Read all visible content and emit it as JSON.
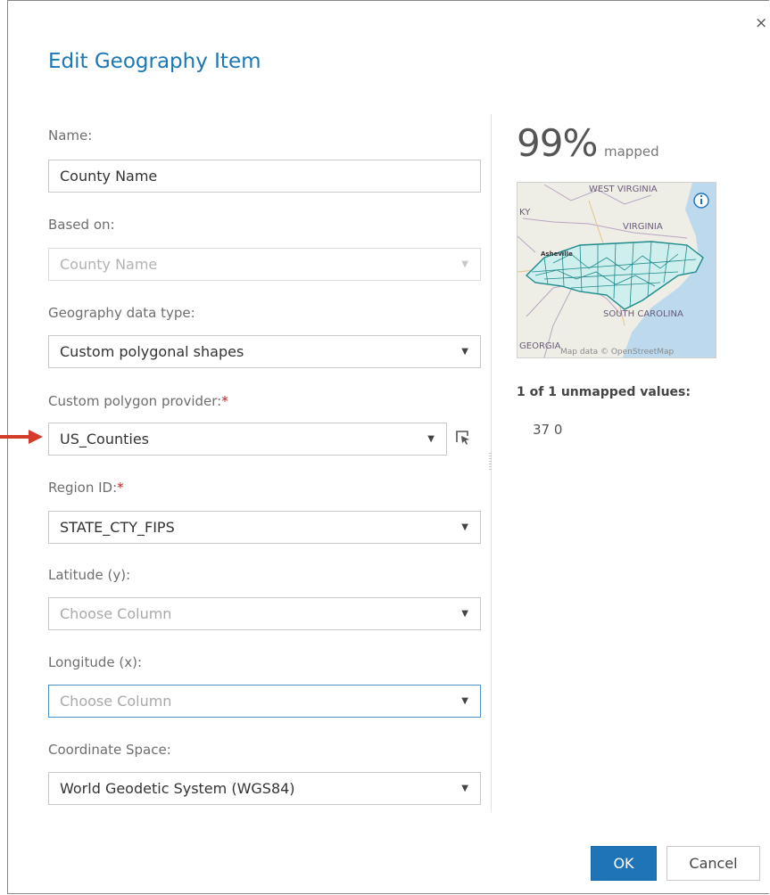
{
  "dialog": {
    "title": "Edit Geography Item",
    "close_label": "×"
  },
  "form": {
    "name_label": "Name:",
    "name_value": "County Name",
    "based_on_label": "Based on:",
    "based_on_value": "County Name",
    "geo_type_label": "Geography data type:",
    "geo_type_value": "Custom polygonal shapes",
    "provider_label": "Custom polygon provider:",
    "provider_value": "US_Counties",
    "region_label": "Region ID:",
    "region_value": "STATE_CTY_FIPS",
    "lat_label": "Latitude (y):",
    "lat_placeholder": "Choose Column",
    "lon_label": "Longitude (x):",
    "lon_placeholder": "Choose Column",
    "coord_label": "Coordinate Space:",
    "coord_value": "World Geodetic System (WGS84)",
    "required_mark": "*"
  },
  "preview": {
    "percent": "99%",
    "percent_label": "mapped",
    "map_labels": {
      "west_virginia": "WEST VIRGINIA",
      "kentucky": "KY",
      "virginia": "VIRGINIA",
      "asheville": "Asheville",
      "south_carolina": "SOUTH CAROLINA",
      "georgia": "GEORGIA",
      "attribution": "Map data © OpenStreetMap"
    },
    "unmapped_title": "1 of 1 unmapped values:",
    "unmapped_values": [
      "37 0"
    ]
  },
  "buttons": {
    "ok": "OK",
    "cancel": "Cancel"
  },
  "icons": {
    "caret": "▼",
    "info": "info-icon",
    "pick": "select-cursor-icon",
    "annotation": "red-arrow"
  },
  "colors": {
    "title": "#1a78b5",
    "primary": "#1f74b8",
    "required": "#c21d1d",
    "focus": "#4a90c8",
    "map_water": "#bcd9ee",
    "map_land": "#eeede6",
    "polygon": "#1e8b8c",
    "arrow": "#d43b2b"
  }
}
